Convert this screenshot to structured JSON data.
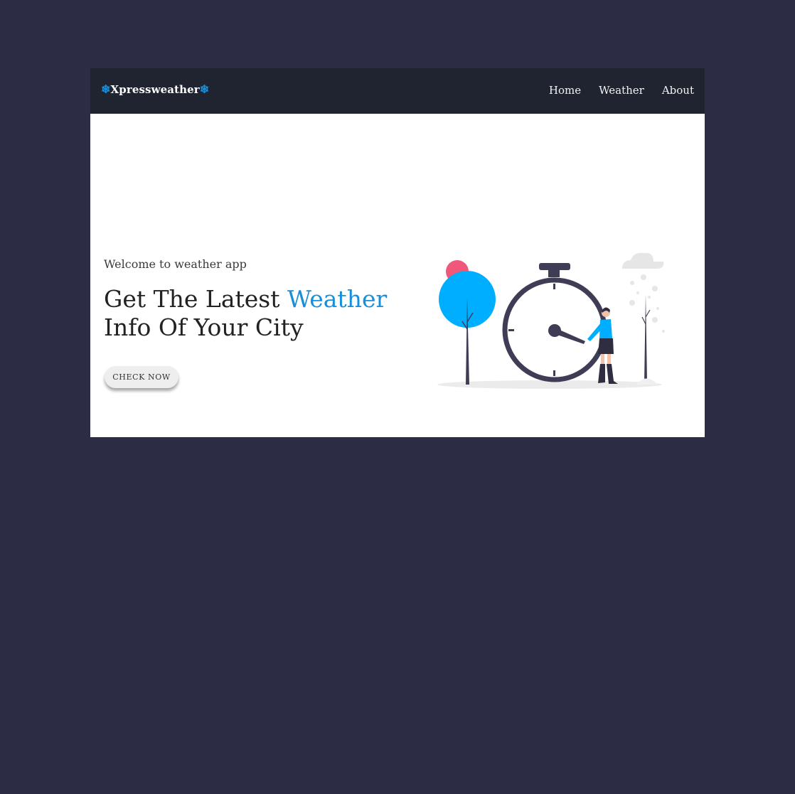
{
  "navbar": {
    "brand": "Xpressweather",
    "brand_icon": "snowflake-icon",
    "links": [
      {
        "label": "Home"
      },
      {
        "label": "Weather"
      },
      {
        "label": "About"
      }
    ]
  },
  "hero": {
    "subtitle": "Welcome to weather app",
    "title_part1": "Get The Latest ",
    "title_accent": "Weather",
    "title_part2": "Info Of Your City",
    "button_label": "CHECK NOW"
  },
  "colors": {
    "page_background": "#2d2c45",
    "navbar": "#1f2430",
    "accent": "#1a8fd9",
    "illustration_blue": "#00aeff",
    "illustration_pink": "#f0577a",
    "illustration_dark": "#3f3d56"
  }
}
